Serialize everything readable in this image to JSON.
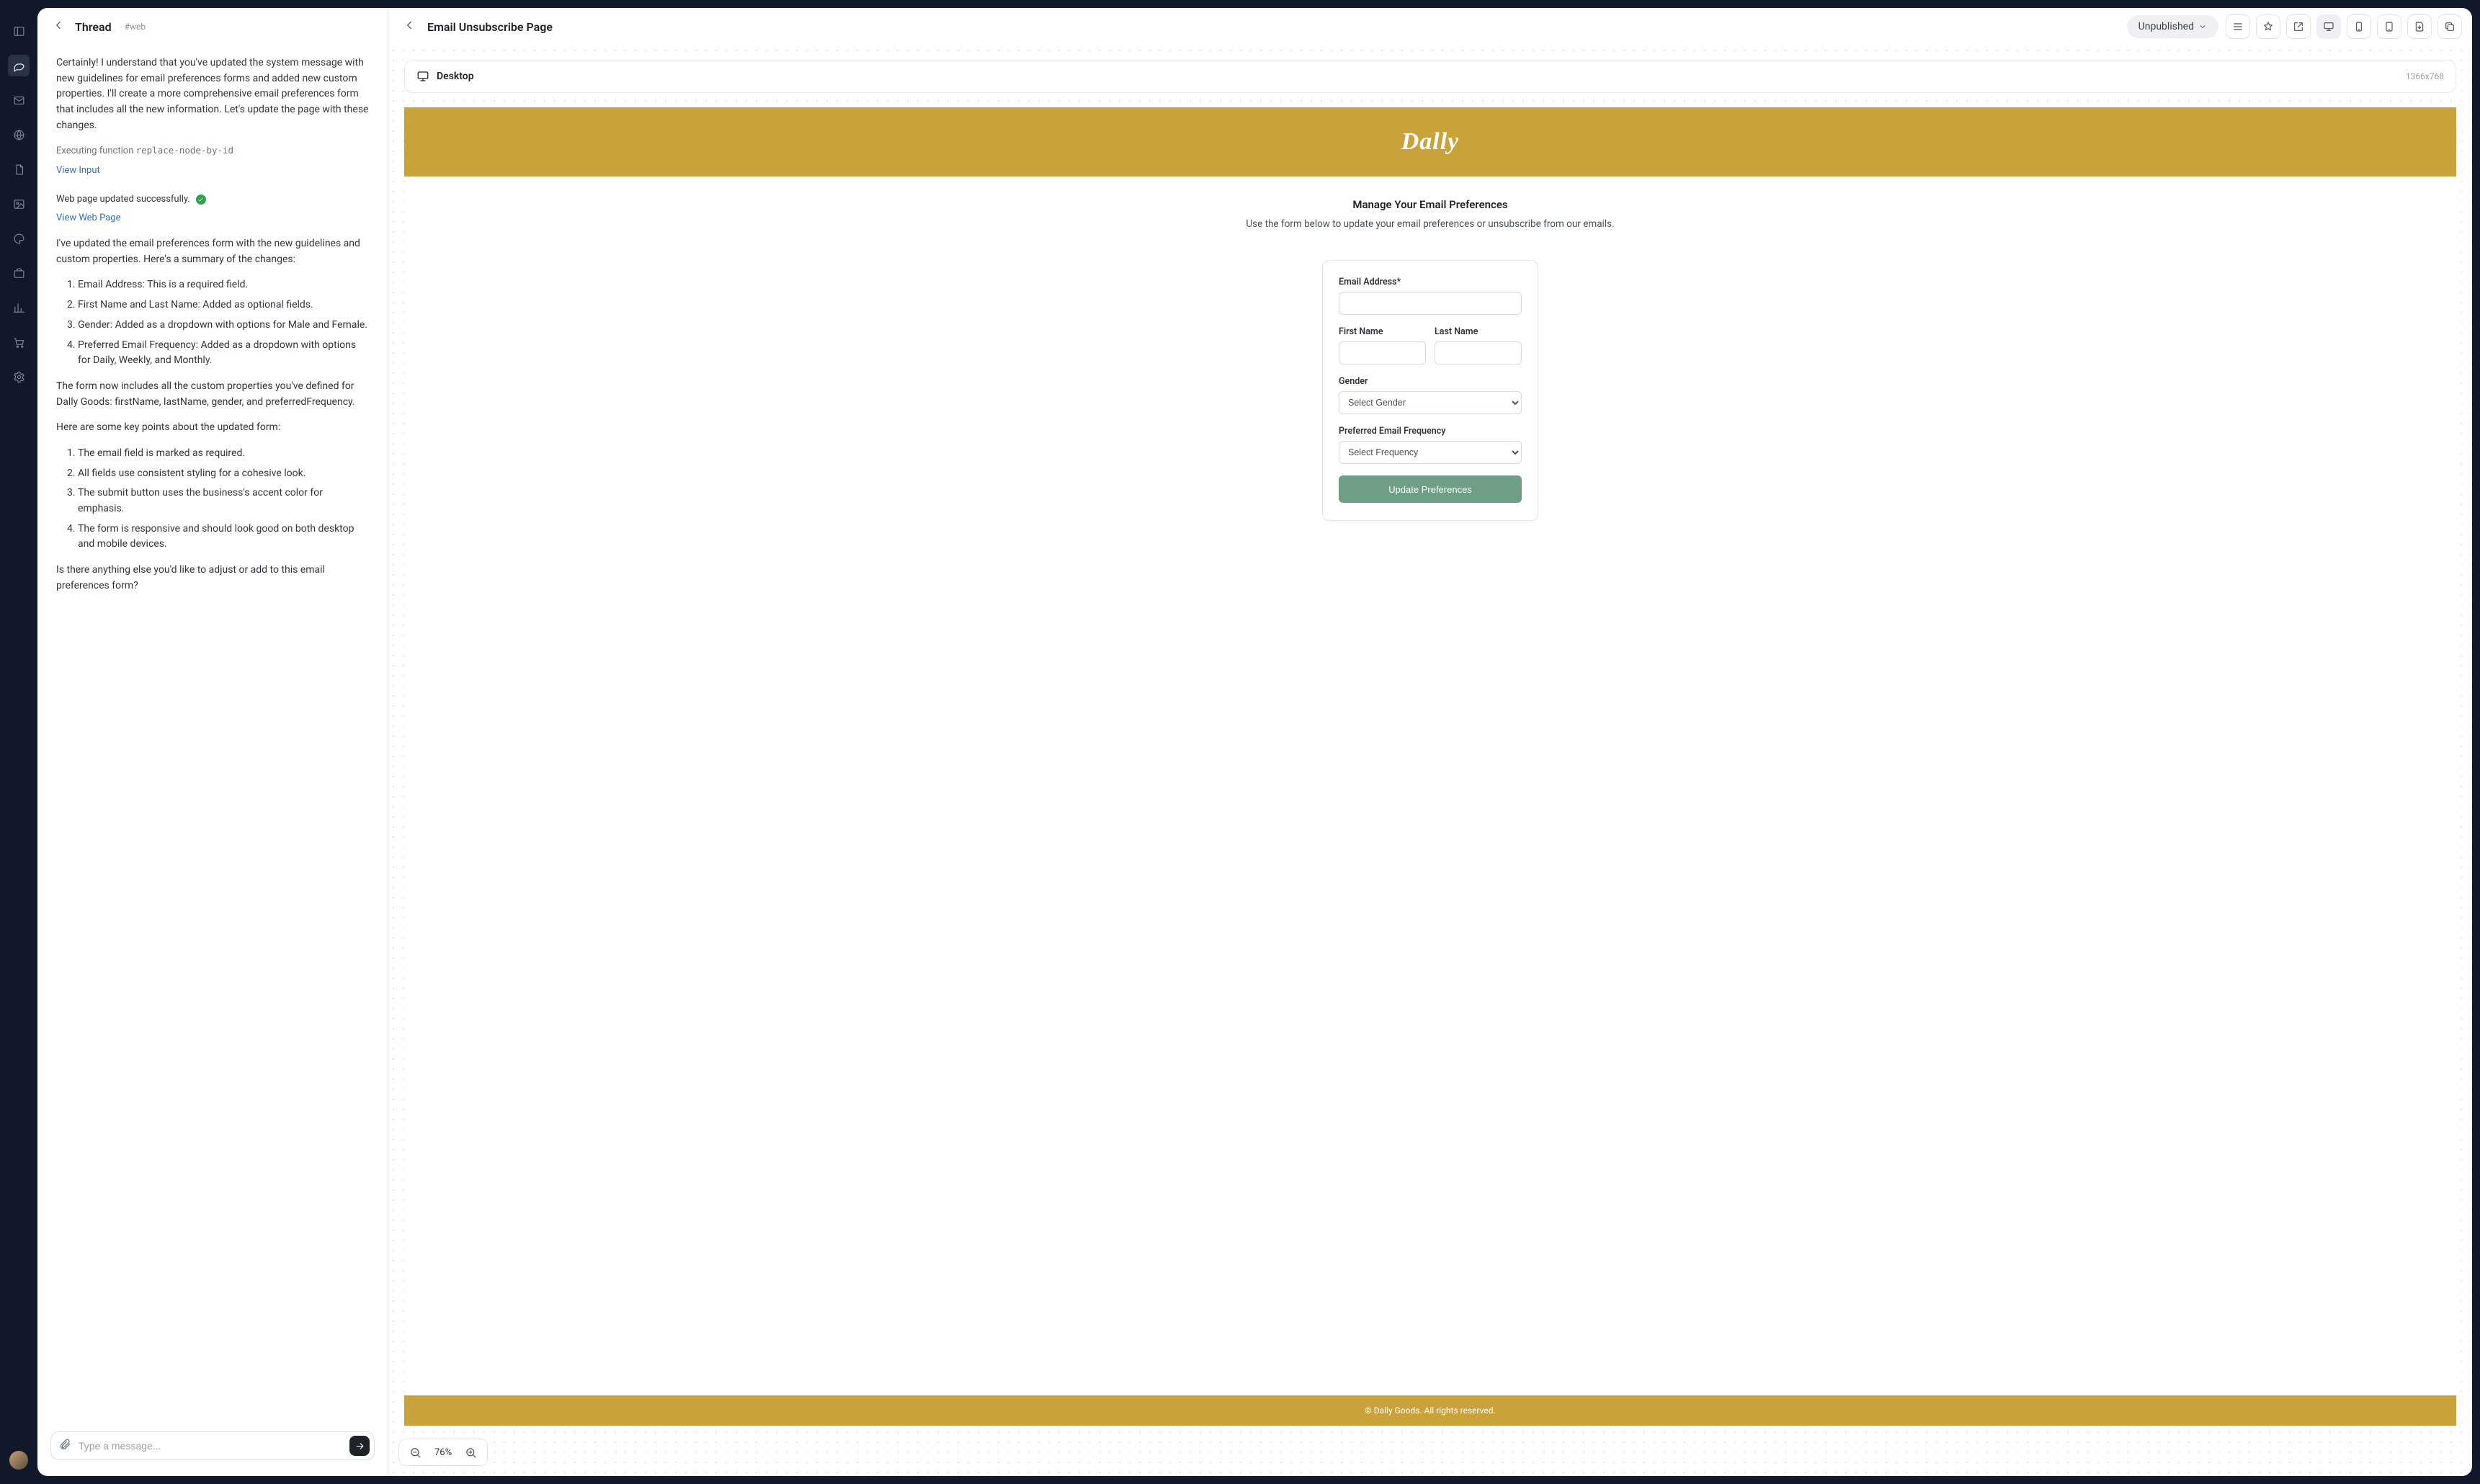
{
  "rail": {
    "items": [
      "panel",
      "chat",
      "mail",
      "globe",
      "doc",
      "image",
      "palette",
      "briefcase",
      "chart",
      "cart",
      "gear"
    ]
  },
  "thread": {
    "title": "Thread",
    "hash": "#web",
    "p_intro": "Certainly! I understand that you've updated the system message with new guidelines for email preferences forms and added new custom properties. I'll create a more comprehensive email preferences form that includes all the new information. Let's update the page with these changes.",
    "exec_prefix": "Executing function ",
    "exec_fn": "replace-node-by-id",
    "view_input": "View Input",
    "success": "Web page updated successfully.",
    "view_page": "View Web Page",
    "p_summary": "I've updated the email preferences form with the new guidelines and custom properties. Here's a summary of the changes:",
    "list1": [
      "Email Address: This is a required field.",
      "First Name and Last Name: Added as optional fields.",
      "Gender: Added as a dropdown with options for Male and Female.",
      "Preferred Email Frequency: Added as a dropdown with options for Daily, Weekly, and Monthly."
    ],
    "p_custom": "The form now includes all the custom properties you've defined for Dally Goods: firstName, lastName, gender, and preferredFrequency.",
    "p_keypoints": "Here are some key points about the updated form:",
    "list2": [
      "The email field is marked as required.",
      "All fields use consistent styling for a cohesive look.",
      "The submit button uses the business's accent color for emphasis.",
      "The form is responsive and should look good on both desktop and mobile devices."
    ],
    "p_outro": "Is there anything else you'd like to adjust or add to this email preferences form?",
    "composer_placeholder": "Type a message..."
  },
  "preview": {
    "title": "Email Unsubscribe Page",
    "status": "Unpublished",
    "device_label": "Desktop",
    "device_dims": "1366x768",
    "zoom": "76%"
  },
  "page": {
    "brand": "Dally",
    "heading": "Manage Your Email Preferences",
    "sub": "Use the form below to update your email preferences or unsubscribe from our emails.",
    "labels": {
      "email": "Email Address*",
      "first": "First Name",
      "last": "Last Name",
      "gender": "Gender",
      "gender_placeholder": "Select Gender",
      "freq": "Preferred Email Frequency",
      "freq_placeholder": "Select Frequency",
      "submit": "Update Preferences"
    },
    "footer": "© Dally Goods. All rights reserved."
  }
}
